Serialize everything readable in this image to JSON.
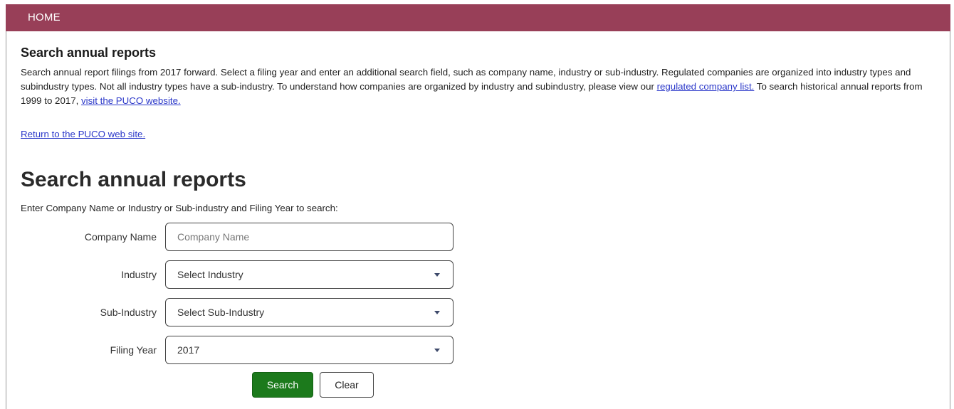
{
  "nav": {
    "home_label": "HOME"
  },
  "intro": {
    "title": "Search annual reports",
    "text1": "Search annual report filings from 2017 forward. Select a filing year and enter an additional search field, such as company name, industry or sub-industry. Regulated companies are organized into industry types and subindustry types. Not all industry types have a sub-industry. To understand how companies are organized by industry and subindustry, please view our ",
    "regulated_link": "regulated company list.",
    "text2": " To search historical annual reports from 1999 to 2017, ",
    "puco_link": "visit the PUCO website.",
    "return_link": "Return to the PUCO web site."
  },
  "search": {
    "title": "Search annual reports",
    "instructions": "Enter Company Name or Industry or Sub-industry and Filing Year to search:",
    "company_label": "Company Name",
    "company_placeholder": "Company Name",
    "company_value": "",
    "industry_label": "Industry",
    "industry_value": "Select Industry",
    "subindustry_label": "Sub-Industry",
    "subindustry_value": "Select Sub-Industry",
    "year_label": "Filing Year",
    "year_value": "2017",
    "search_button": "Search",
    "clear_button": "Clear"
  },
  "colors": {
    "nav_bg": "#983f58",
    "search_button_bg": "#1c7a1c",
    "link": "#2a37c9"
  }
}
